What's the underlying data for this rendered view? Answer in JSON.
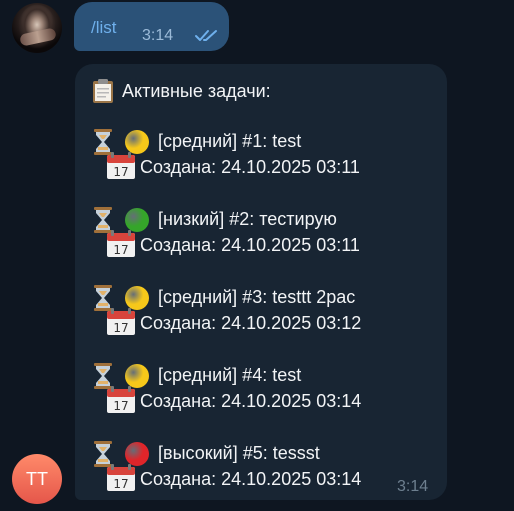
{
  "outgoing": {
    "text": "/list",
    "time": "3:14",
    "status_icon": "double-check-icon",
    "avatar_icon": "user-avatar-image"
  },
  "incoming": {
    "header_icon": "clipboard-icon",
    "header": "Активные задачи:",
    "time": "3:14",
    "tasks": [
      {
        "line": "[средний] #1: test",
        "created": "Создана: 24.10.2025 03:11",
        "dot_color": "#f6c81a"
      },
      {
        "line": "[низкий] #2: тестирую",
        "created": "Создана: 24.10.2025 03:11",
        "dot_color": "#35a52a"
      },
      {
        "line": "[средний] #3: testtt 2рас",
        "created": "Создана: 24.10.2025 03:12",
        "dot_color": "#f6c81a"
      },
      {
        "line": "[средний] #4: test",
        "created": "Создана: 24.10.2025 03:14",
        "dot_color": "#f6c81a"
      },
      {
        "line": "[высокий] #5: tessst",
        "created": "Создана: 24.10.2025 03:14",
        "dot_color": "#e0252a"
      }
    ],
    "avatar_initials": "TT"
  },
  "colors": {
    "background": "#0e1621",
    "outgoing_bubble": "#2b5278",
    "incoming_bubble": "#182533",
    "link": "#6fb0ec",
    "avatar_bot": "#e5564a"
  }
}
